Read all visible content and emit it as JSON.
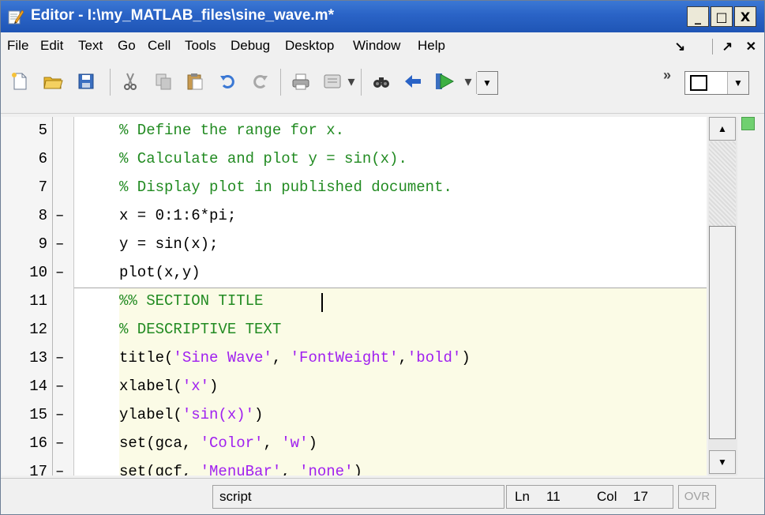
{
  "window": {
    "title": "Editor - I:\\my_MATLAB_files\\sine_wave.m*",
    "controls": {
      "minimize": "_",
      "maximize": "□",
      "close": "X"
    }
  },
  "menu": {
    "items": [
      "File",
      "Edit",
      "Text",
      "Go",
      "Cell",
      "Tools",
      "Debug",
      "Desktop",
      "Window",
      "Help"
    ],
    "right": {
      "dock": "↘",
      "undock": "↗",
      "close": "✕"
    }
  },
  "toolbar": {
    "icons": [
      "new-file-icon",
      "open-folder-icon",
      "save-icon",
      "cut-icon",
      "copy-icon",
      "paste-icon",
      "undo-icon",
      "redo-icon",
      "print-icon",
      "publish-icon",
      "find-icon",
      "back-arrow-icon",
      "run-icon"
    ],
    "overflow": "»"
  },
  "editor": {
    "lines": [
      {
        "num": "5",
        "mark": "",
        "segments": [
          {
            "t": "% Define the range for x.",
            "c": "comment"
          }
        ]
      },
      {
        "num": "6",
        "mark": "",
        "segments": [
          {
            "t": "% Calculate and plot y = sin(x).",
            "c": "comment"
          }
        ]
      },
      {
        "num": "7",
        "mark": "",
        "segments": [
          {
            "t": "% Display plot in published document.",
            "c": "comment"
          }
        ]
      },
      {
        "num": "8",
        "mark": "–",
        "segments": [
          {
            "t": "x = 0:1:6*pi;",
            "c": "code"
          }
        ]
      },
      {
        "num": "9",
        "mark": "–",
        "segments": [
          {
            "t": "y = sin(x);",
            "c": "code"
          }
        ]
      },
      {
        "num": "10",
        "mark": "–",
        "segments": [
          {
            "t": "plot(x,y)",
            "c": "code"
          }
        ]
      },
      {
        "num": "11",
        "mark": "",
        "segments": [
          {
            "t": "%% SECTION TITLE",
            "c": "comment"
          }
        ]
      },
      {
        "num": "12",
        "mark": "",
        "segments": [
          {
            "t": "% DESCRIPTIVE TEXT",
            "c": "comment"
          }
        ]
      },
      {
        "num": "13",
        "mark": "–",
        "segments": [
          {
            "t": "title(",
            "c": "code"
          },
          {
            "t": "'Sine Wave'",
            "c": "string"
          },
          {
            "t": ", ",
            "c": "code"
          },
          {
            "t": "'FontWeight'",
            "c": "string"
          },
          {
            "t": ",",
            "c": "code"
          },
          {
            "t": "'bold'",
            "c": "string"
          },
          {
            "t": ")",
            "c": "code"
          }
        ]
      },
      {
        "num": "14",
        "mark": "–",
        "segments": [
          {
            "t": "xlabel(",
            "c": "code"
          },
          {
            "t": "'x'",
            "c": "string"
          },
          {
            "t": ")",
            "c": "code"
          }
        ]
      },
      {
        "num": "15",
        "mark": "–",
        "segments": [
          {
            "t": "ylabel(",
            "c": "code"
          },
          {
            "t": "'sin(x)'",
            "c": "string"
          },
          {
            "t": ")",
            "c": "code"
          }
        ]
      },
      {
        "num": "16",
        "mark": "–",
        "segments": [
          {
            "t": "set(gca, ",
            "c": "code"
          },
          {
            "t": "'Color'",
            "c": "string"
          },
          {
            "t": ", ",
            "c": "code"
          },
          {
            "t": "'w'",
            "c": "string"
          },
          {
            "t": ")",
            "c": "code"
          }
        ]
      },
      {
        "num": "17",
        "mark": "–",
        "segments": [
          {
            "t": "set(gcf, ",
            "c": "code"
          },
          {
            "t": "'MenuBar'",
            "c": "string"
          },
          {
            "t": ", ",
            "c": "code"
          },
          {
            "t": "'none'",
            "c": "string"
          },
          {
            "t": ")",
            "c": "code"
          }
        ]
      }
    ],
    "colors": {
      "comment": "#228b22",
      "string": "#a020f0",
      "code": "#000000",
      "cell_highlight": "#fbfbe6"
    }
  },
  "status": {
    "mode": "script",
    "ln_label": "Ln",
    "ln": "11",
    "col_label": "Col",
    "col": "17",
    "ovr": "OVR"
  }
}
